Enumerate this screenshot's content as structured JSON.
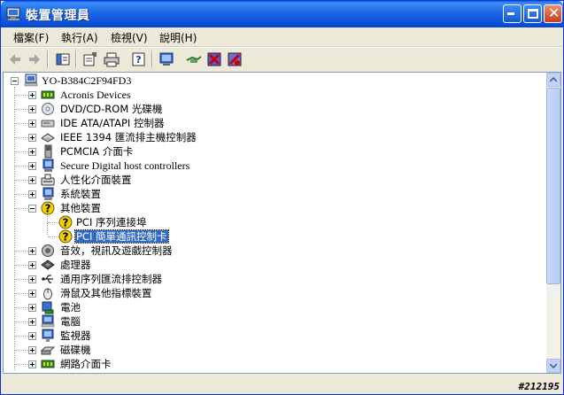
{
  "window": {
    "title": "裝置管理員"
  },
  "menu": [
    {
      "label": "檔案(F)"
    },
    {
      "label": "執行(A)"
    },
    {
      "label": "檢視(V)"
    },
    {
      "label": "說明(H)"
    }
  ],
  "toolbar": {
    "buttons": [
      "back-icon",
      "forward-icon",
      "show-hide-tree-icon",
      "properties-icon",
      "print-icon",
      "help-icon",
      "scan-hardware-icon",
      "update-driver-icon",
      "uninstall-icon",
      "disable-icon"
    ]
  },
  "tree": {
    "root": "YO-B384C2F94FD3",
    "items": [
      {
        "label": "Acronis Devices"
      },
      {
        "label": "DVD/CD-ROM 光碟機"
      },
      {
        "label": "IDE ATA/ATAPI 控制器"
      },
      {
        "label": "IEEE 1394 匯流排主機控制器"
      },
      {
        "label": "PCMCIA 介面卡"
      },
      {
        "label": "Secure Digital host controllers"
      },
      {
        "label": "人性化介面裝置"
      },
      {
        "label": "系統裝置"
      },
      {
        "label": "其他裝置"
      },
      {
        "label": "PCI 序列連接埠"
      },
      {
        "label": "PCI 簡單通訊控制卡"
      },
      {
        "label": "音效，視訊及遊戲控制器"
      },
      {
        "label": "處理器"
      },
      {
        "label": "通用序列匯流排控制器"
      },
      {
        "label": "滑鼠及其他指標裝置"
      },
      {
        "label": "電池"
      },
      {
        "label": "電腦"
      },
      {
        "label": "監視器"
      },
      {
        "label": "磁碟機"
      },
      {
        "label": "網路介面卡"
      }
    ]
  },
  "watermark": "#212195"
}
